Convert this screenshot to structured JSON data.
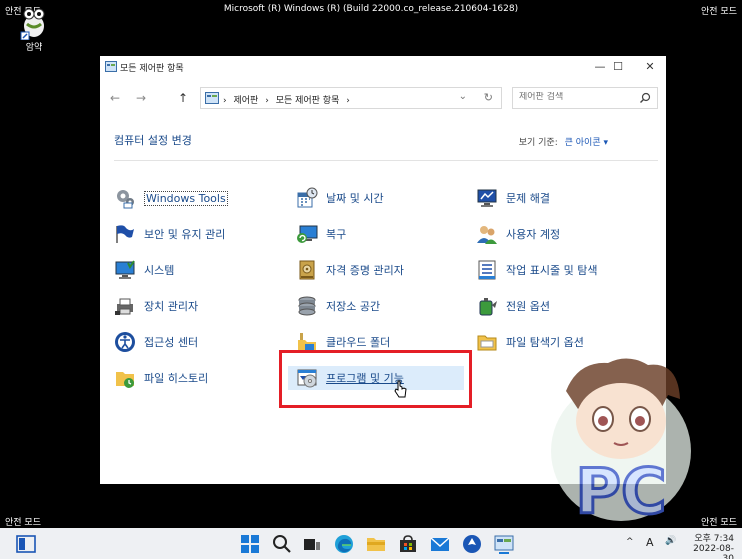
{
  "safe_mode": "안전 모드",
  "system_title": "Microsoft (R) Windows (R) (Build 22000.co_release.210604-1628)",
  "desktop": {
    "icon_label": "암약"
  },
  "window": {
    "title": "모든 제어판 항목",
    "controls": {
      "minimize": "—",
      "maximize": "☐",
      "close": "✕"
    },
    "nav": {
      "back": "←",
      "forward": "→",
      "up": "↑"
    },
    "address": {
      "crumbs": [
        "›",
        "제어판",
        "›",
        "모든 제어판 항목",
        "›"
      ],
      "dropdown": "⌄",
      "refresh": "↻"
    },
    "search": {
      "placeholder": "제어판 검색"
    },
    "heading": "컴퓨터 설정 변경",
    "view_by": {
      "label": "보기 기준:",
      "value": "큰 아이콘 ▾"
    },
    "items": [
      {
        "label": "Windows Tools",
        "icon": "gear-icon"
      },
      {
        "label": "날짜 및 시간",
        "icon": "calendar-clock-icon"
      },
      {
        "label": "문제 해결",
        "icon": "troubleshoot-icon"
      },
      {
        "label": "보안 및 유지 관리",
        "icon": "flag-icon"
      },
      {
        "label": "복구",
        "icon": "recovery-icon"
      },
      {
        "label": "사용자 계정",
        "icon": "users-icon"
      },
      {
        "label": "시스템",
        "icon": "monitor-check-icon"
      },
      {
        "label": "자격 증명 관리자",
        "icon": "credential-vault-icon"
      },
      {
        "label": "작업 표시줄 및 탐색",
        "icon": "taskbar-icon"
      },
      {
        "label": "장치 관리자",
        "icon": "printer-icon"
      },
      {
        "label": "저장소 공간",
        "icon": "storage-icon"
      },
      {
        "label": "전원 옵션",
        "icon": "power-icon"
      },
      {
        "label": "접근성 센터",
        "icon": "accessibility-icon"
      },
      {
        "label": "클라우드 폴더",
        "icon": "cloud-folder-icon"
      },
      {
        "label": "파일 탐색기 옵션",
        "icon": "folder-options-icon"
      },
      {
        "label": "파일 히스토리",
        "icon": "file-history-icon"
      },
      {
        "label": "프로그램 및 기능",
        "icon": "programs-icon"
      }
    ]
  },
  "watermark": {
    "text": "PC"
  },
  "taskbar": {
    "tray": {
      "chevron": "^",
      "ime": "A",
      "volume": "🔊",
      "time": "오후 7:34",
      "date": "2022-08-30"
    }
  },
  "colors": {
    "link": "#1a4a8a",
    "highlight_bg": "#dcecfb",
    "red_box": "#e41e26",
    "taskbar": "#eef0f3"
  }
}
